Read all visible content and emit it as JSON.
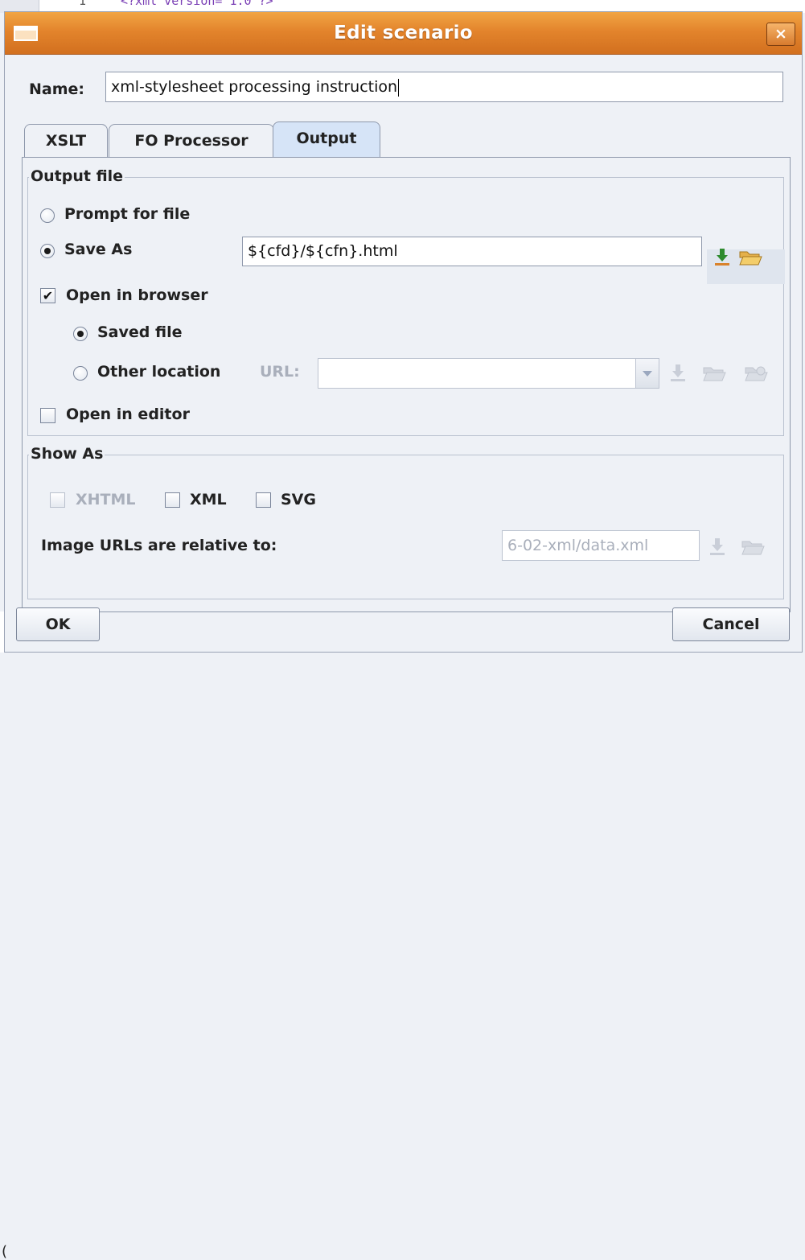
{
  "background": {
    "line_number": "1",
    "code_line": "<?xml version=\"1.0\"?>",
    "stray_char": "("
  },
  "dialog": {
    "title": "Edit scenario",
    "close_glyph": "×",
    "name_label": "Name:",
    "name_value": "xml-stylesheet processing instruction",
    "tabs": [
      "XSLT",
      "FO Processor",
      "Output"
    ],
    "active_tab": "Output"
  },
  "output": {
    "group_label": "Output file",
    "prompt_label": "Prompt for file",
    "save_as_label": "Save As",
    "save_as_value": "${cfd}/${cfn}.html",
    "save_as_selected": true,
    "open_browser_label": "Open in browser",
    "open_browser_checked": true,
    "saved_file_label": "Saved file",
    "other_location_label": "Other location",
    "url_label": "URL:",
    "url_value": "",
    "open_editor_label": "Open in editor",
    "open_editor_checked": false
  },
  "show_as": {
    "group_label": "Show As",
    "xhtml_label": "XHTML",
    "xml_label": "XML",
    "svg_label": "SVG",
    "image_urls_label": "Image URLs are relative to:",
    "image_urls_value": "6-02-xml/data.xml"
  },
  "buttons": {
    "ok": "OK",
    "cancel": "Cancel"
  },
  "colors": {
    "titlebar": "#e3842c",
    "active_tab": "#d6e4f7",
    "disabled_text": "#a9afbb"
  }
}
